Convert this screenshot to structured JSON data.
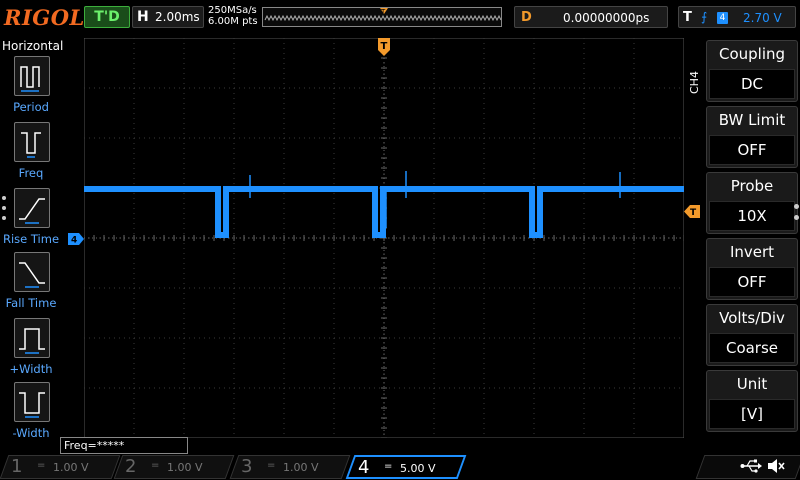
{
  "topbar": {
    "logo": "RIGOL",
    "run_status": "T'D",
    "horizontal": {
      "label": "H",
      "timebase": "2.00ms"
    },
    "sample_rate": "250MSa/s",
    "memory_depth": "6.00M pts",
    "delay": {
      "label": "D",
      "value": "0.00000000ps"
    },
    "trigger": {
      "label": "T",
      "source": "4",
      "level": "2.70 V"
    }
  },
  "left_panel": {
    "title": "Horizontal",
    "items": [
      {
        "label": "Period",
        "icon": "period-icon"
      },
      {
        "label": "Freq",
        "icon": "freq-icon"
      },
      {
        "label": "Rise Time",
        "icon": "rise-time-icon"
      },
      {
        "label": "Fall Time",
        "icon": "fall-time-icon"
      },
      {
        "label": "+Width",
        "icon": "positive-width-icon"
      },
      {
        "label": "-Width",
        "icon": "negative-width-icon"
      }
    ]
  },
  "waveform": {
    "channel": "4",
    "color": "#1e90ff",
    "trigger_marker": "T",
    "measurement": "Freq=*****"
  },
  "right_menu": {
    "channel_label": "CH4",
    "items": [
      {
        "title": "Coupling",
        "value": "DC"
      },
      {
        "title": "BW Limit",
        "value": "OFF"
      },
      {
        "title": "Probe",
        "value": "10X"
      },
      {
        "title": "Invert",
        "value": "OFF"
      },
      {
        "title": "Volts/Div",
        "value": "Coarse"
      },
      {
        "title": "Unit",
        "value": "[V]"
      }
    ]
  },
  "channels": [
    {
      "num": "1",
      "coupling": "=",
      "scale": "1.00 V",
      "active": false,
      "color": "#f5e52a"
    },
    {
      "num": "2",
      "coupling": "=",
      "scale": "1.00 V",
      "active": false,
      "color": "#2ae5e5"
    },
    {
      "num": "3",
      "coupling": "=",
      "scale": "1.00 V",
      "active": false,
      "color": "#e52ae5"
    },
    {
      "num": "4",
      "coupling": "=",
      "scale": "5.00 V",
      "active": true,
      "color": "#1e90ff"
    }
  ],
  "colors": {
    "logo": "#f26a21",
    "trigger_orange": "#f39a2b",
    "ch4_blue": "#1e90ff",
    "run_green": "#6cf06c"
  }
}
